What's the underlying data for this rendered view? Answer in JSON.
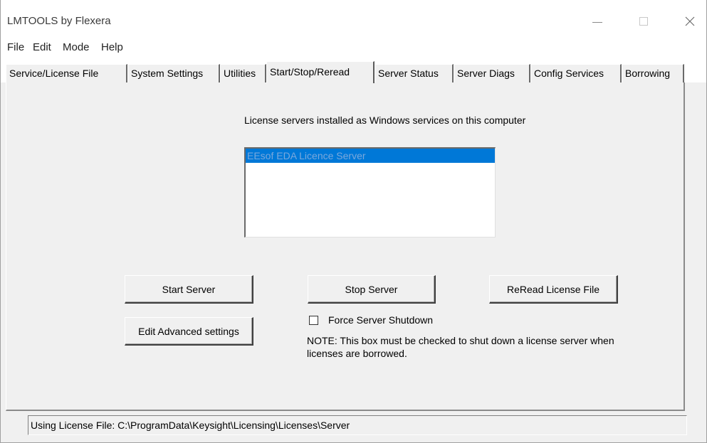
{
  "window": {
    "title": "LMTOOLS by Flexera"
  },
  "menu": {
    "items": [
      "File",
      "Edit",
      "Mode",
      "Help"
    ]
  },
  "tabs": [
    {
      "label": "Service/License File",
      "active": false
    },
    {
      "label": "System Settings",
      "active": false
    },
    {
      "label": "Utilities",
      "active": false
    },
    {
      "label": "Start/Stop/Reread",
      "active": true
    },
    {
      "label": "Server Status",
      "active": false
    },
    {
      "label": "Server Diags",
      "active": false
    },
    {
      "label": "Config Services",
      "active": false
    },
    {
      "label": "Borrowing",
      "active": false
    }
  ],
  "services": {
    "caption": "License servers installed as Windows services on this computer",
    "items": [
      {
        "label": "EEsof EDA Licence Server",
        "selected": true
      }
    ]
  },
  "buttons": {
    "start": "Start Server",
    "stop": "Stop Server",
    "reread": "ReRead License File",
    "advanced": "Edit Advanced settings"
  },
  "force_shutdown": {
    "label": "Force Server Shutdown",
    "checked": false,
    "note": "NOTE:  This box must be checked to shut down a license server when licenses are borrowed."
  },
  "status": {
    "text": "Using License File:  C:\\ProgramData\\Keysight\\Licensing\\Licenses\\Server"
  },
  "colors": {
    "selection": "#0078d7",
    "window_bg": "#f0f0f0"
  }
}
